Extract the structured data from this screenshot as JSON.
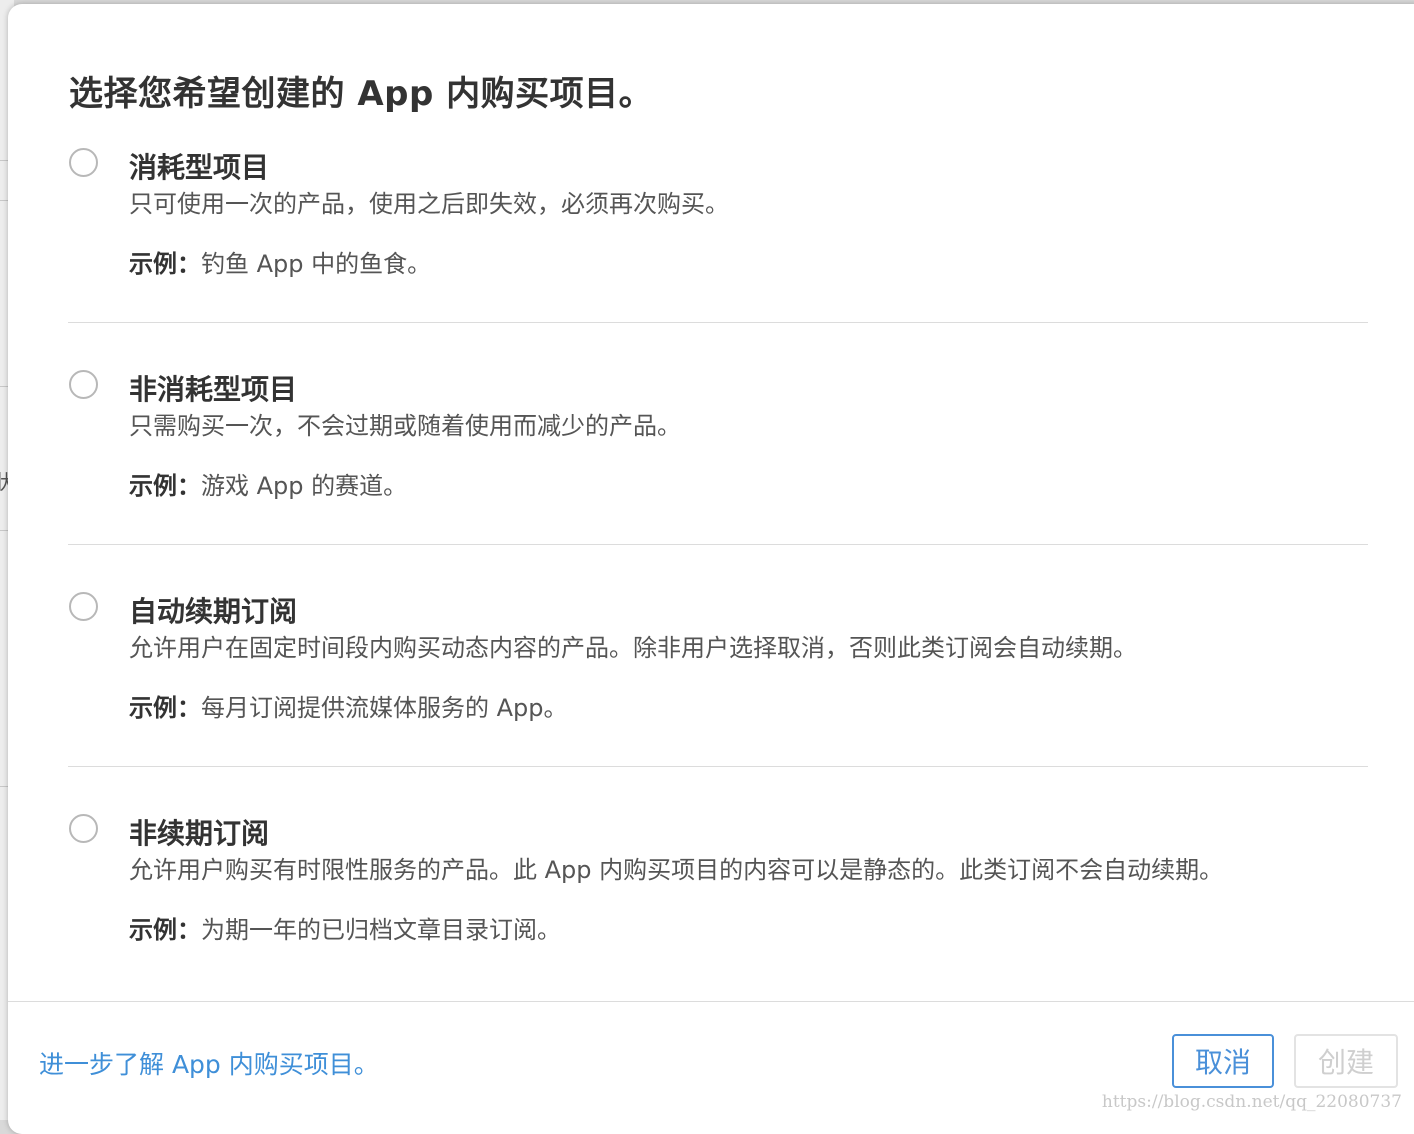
{
  "dialog": {
    "title": "选择您希望创建的 App 内购买项目。",
    "options": [
      {
        "title": "消耗型项目",
        "description": "只可使用一次的产品，使用之后即失效，必须再次购买。",
        "example_label": "示例：",
        "example_text": "钓鱼 App 中的鱼食。",
        "selected": false
      },
      {
        "title": "非消耗型项目",
        "description": "只需购买一次，不会过期或随着使用而减少的产品。",
        "example_label": "示例：",
        "example_text": "游戏 App 的赛道。",
        "selected": false
      },
      {
        "title": "自动续期订阅",
        "description": "允许用户在固定时间段内购买动态内容的产品。除非用户选择取消，否则此类订阅会自动续期。",
        "example_label": "示例：",
        "example_text": "每月订阅提供流媒体服务的 App。",
        "selected": false
      },
      {
        "title": "非续期订阅",
        "description": "允许用户购买有时限性服务的产品。此 App 内购买项目的内容可以是静态的。此类订阅不会自动续期。",
        "example_label": "示例：",
        "example_text": "为期一年的已归档文章目录订阅。",
        "selected": false
      }
    ],
    "footer": {
      "learn_more_link": "进一步了解 App 内购买项目。",
      "cancel_label": "取消",
      "create_label": "创建"
    }
  },
  "background_partial_char": "状",
  "watermark": "https://blog.csdn.net/qq_22080737",
  "colors": {
    "link": "#3f8fd8",
    "primary_button": "#4a90d9",
    "disabled_button": "#cfcfcf",
    "radio_border": "#b8b8b8"
  }
}
